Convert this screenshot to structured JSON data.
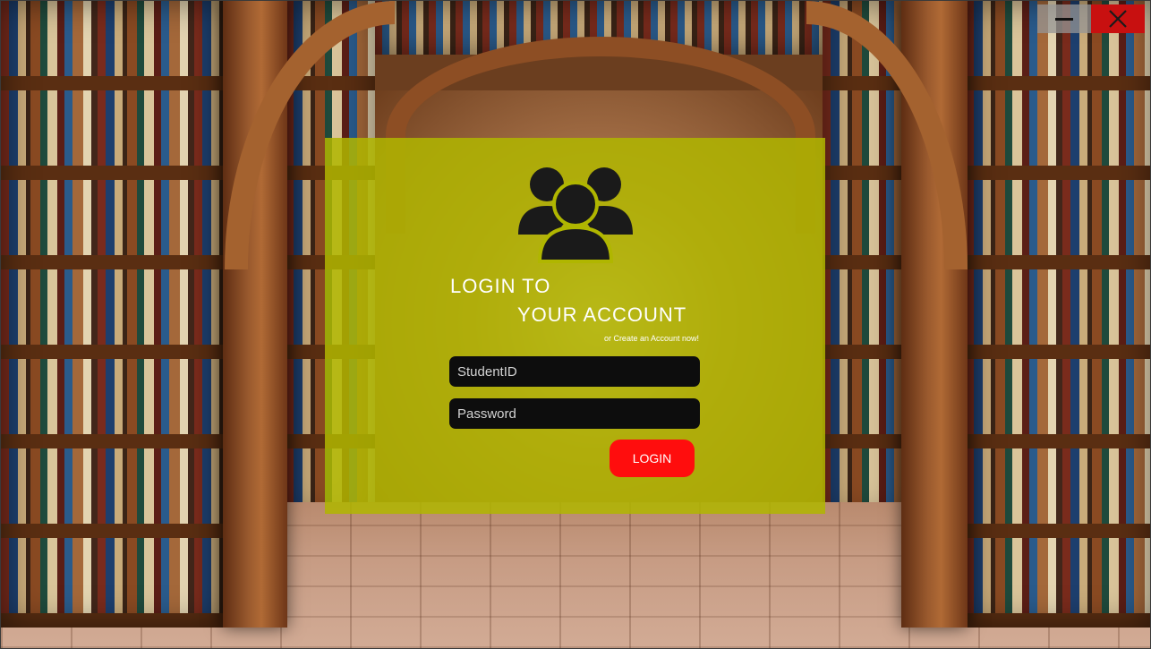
{
  "window": {
    "minimize_icon": "minimize-icon",
    "close_icon": "close-icon",
    "close_color": "#c81010"
  },
  "login": {
    "panel_color": "#b0b600",
    "icon": "users-group-icon",
    "title_line1": "LOGIN TO",
    "title_line2": "YOUR ACCOUNT",
    "create_account_link": "or Create an Account now!",
    "student_id_placeholder": "StudentID",
    "student_id_value": "",
    "password_placeholder": "Password",
    "password_value": "",
    "login_button": "LOGIN",
    "login_button_color": "#ff0d0d"
  }
}
